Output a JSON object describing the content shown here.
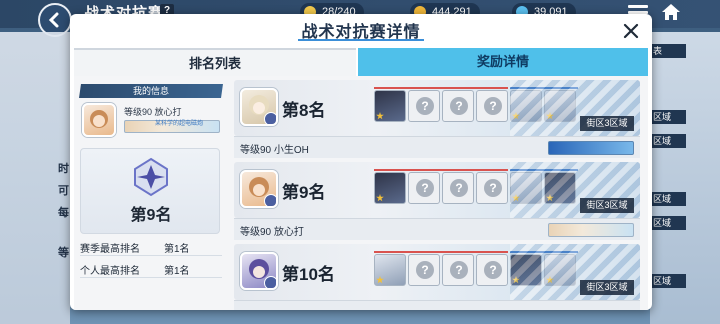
{
  "background": {
    "title": "战术对抗赛",
    "help_icon": "?",
    "stamina": "28/240",
    "credits": "444,291",
    "pyroxene": "39,091",
    "left_labels": [
      "时",
      "可",
      "每",
      "等"
    ],
    "right_tags": [
      "表",
      "区域",
      "区域",
      "区域",
      "区域",
      "区域"
    ]
  },
  "modal": {
    "title": "战术对抗赛详情",
    "tabs": [
      {
        "label": "排名列表",
        "active": true
      },
      {
        "label": "奖励详情",
        "active": false
      }
    ]
  },
  "my_info": {
    "header": "我的信息",
    "level_name": "等级90 放心打",
    "badge_text": "某科学的超电磁炮",
    "rank": "第9名",
    "stats": [
      {
        "label": "赛季最高排名",
        "value": "第1名"
      },
      {
        "label": "个人最高排名",
        "value": "第1名"
      }
    ]
  },
  "rankings": [
    {
      "rank": "第8名",
      "level_name": "等级90 小生OH",
      "zone": "街区3区域",
      "slots": [
        "char",
        "empty",
        "empty",
        "empty",
        "char",
        "char"
      ]
    },
    {
      "rank": "第9名",
      "level_name": "等级90 放心打",
      "zone": "街区3区域",
      "slots": [
        "char",
        "empty",
        "empty",
        "empty",
        "char",
        "char"
      ]
    },
    {
      "rank": "第10名",
      "level_name": "",
      "zone": "街区3区域",
      "slots": [
        "char",
        "empty",
        "empty",
        "empty",
        "char",
        "char"
      ]
    }
  ],
  "empty_slot_symbol": "?",
  "colors": {
    "accent_blue": "#4fc0ea",
    "title_underline": "#3a8ed8",
    "team_red": "#d9534f",
    "team_blue": "#3a78c8"
  }
}
